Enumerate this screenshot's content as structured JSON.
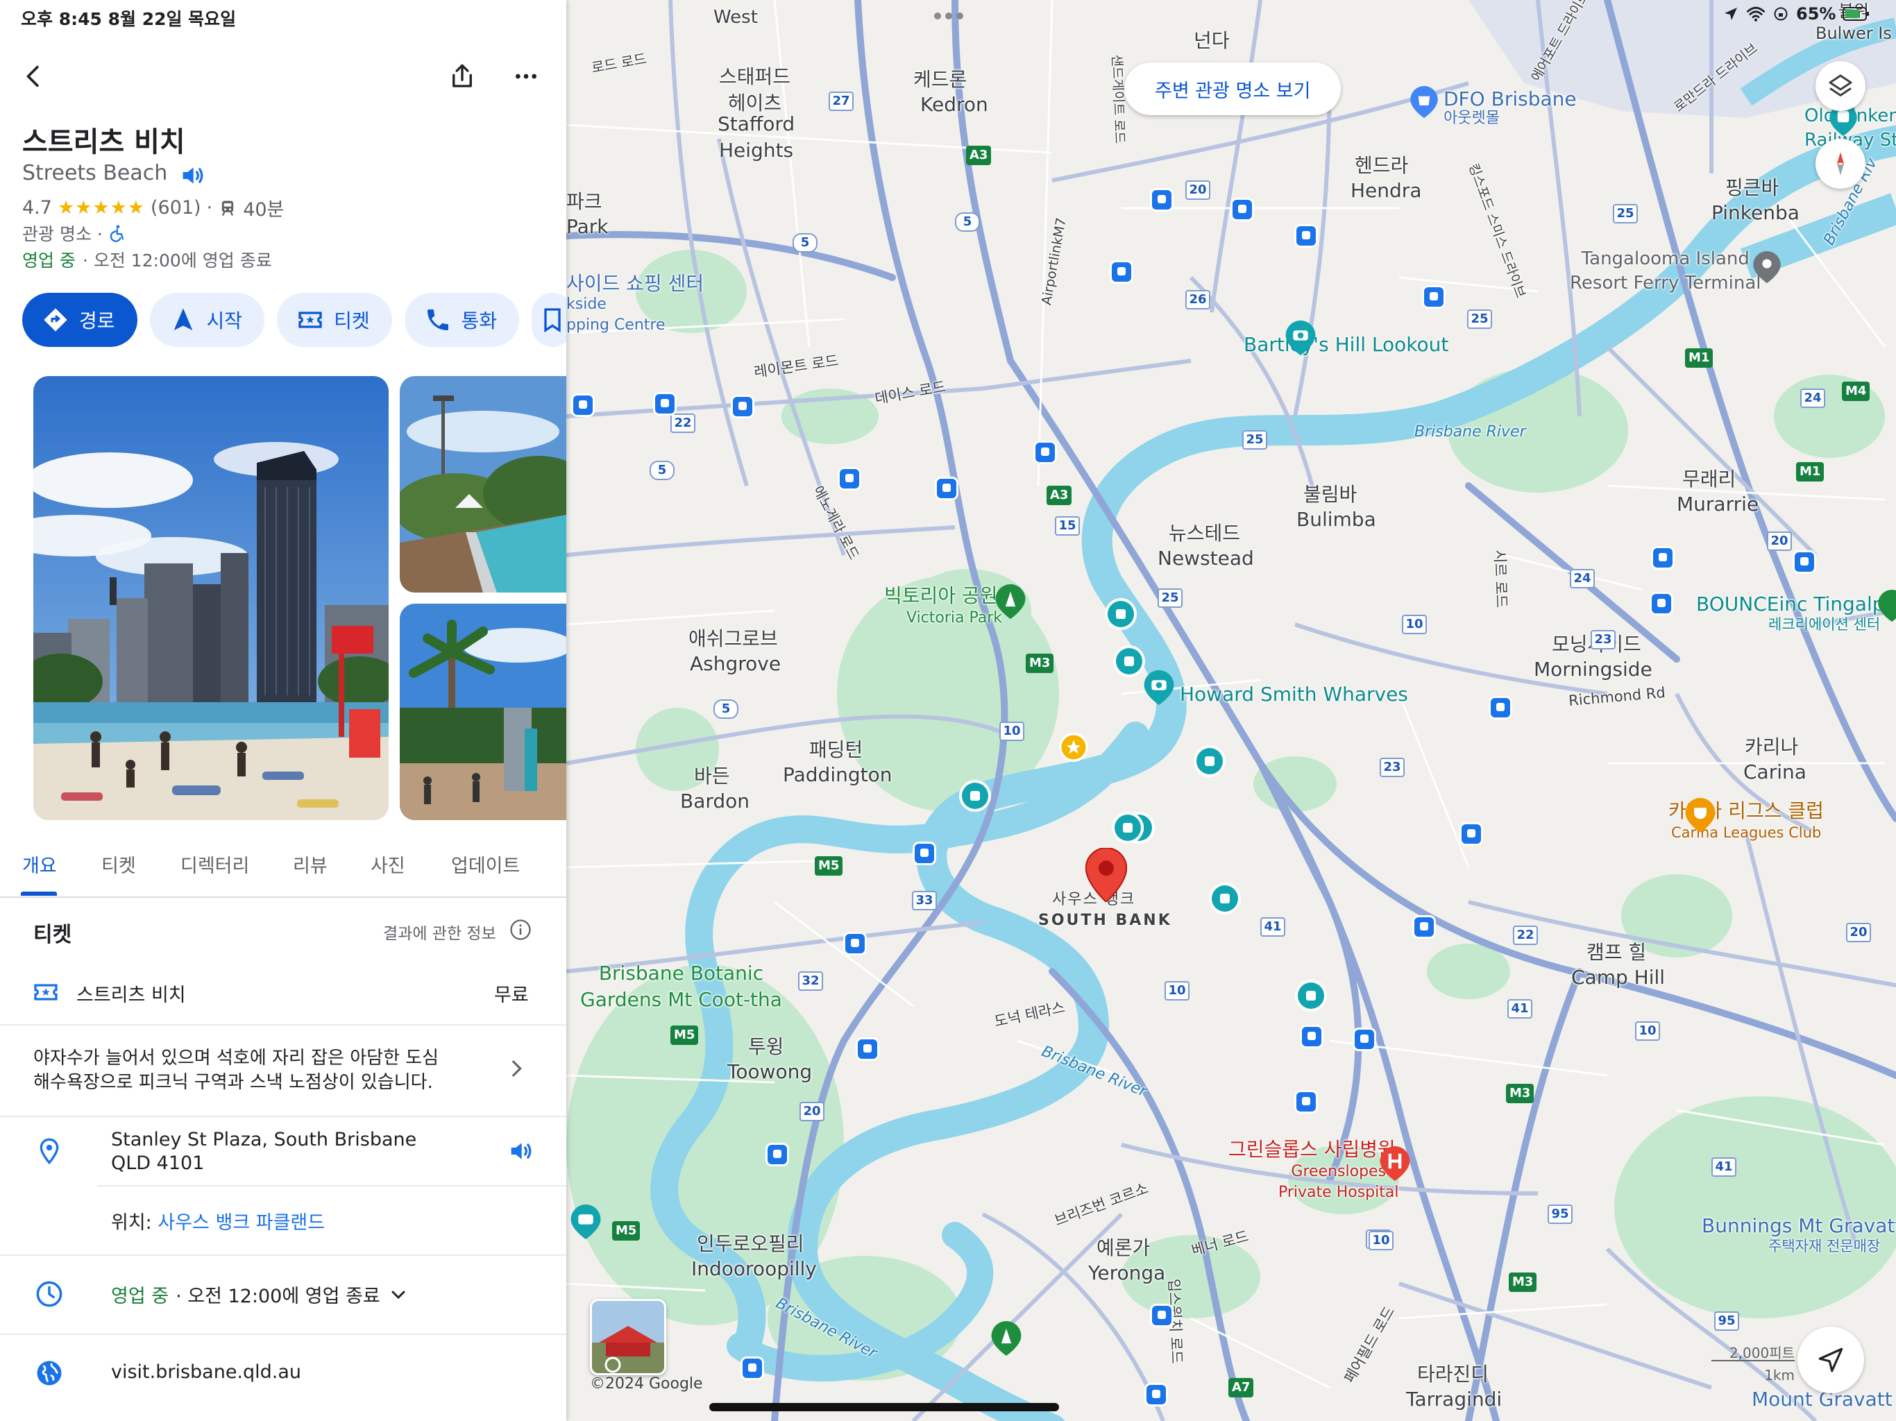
{
  "status_bar": {
    "time_date": "오후 8:45   8월 22일 목요일",
    "battery": "65%"
  },
  "place": {
    "title": "스트리츠 비치",
    "subtitle": "Streets Beach",
    "rating": "4.7",
    "stars": "★★★★★",
    "reviews": "(601)",
    "transit_time": "40분",
    "category": "관광 명소 ·",
    "open_status": "영업 중",
    "hours_summary": "· 오전 12:00에 영업 종료"
  },
  "actions": {
    "directions": "경로",
    "start": "시작",
    "tickets": "티켓",
    "call": "통화"
  },
  "tabs": [
    "개요",
    "티켓",
    "디렉터리",
    "리뷰",
    "사진",
    "업데이트"
  ],
  "tickets_section": {
    "title": "티켓",
    "about": "결과에 관한 정보",
    "item_name": "스트리츠 비치",
    "item_price": "무료"
  },
  "description": {
    "line1": "야자수가 늘어서 있으며 석호에 자리 잡은 아담한 도심",
    "line2": "해수욕장으로 피크닉 구역과 스낵 노점상이 있습니다."
  },
  "address": {
    "line1": "Stanley St Plaza, South Brisbane",
    "line2": "QLD 4101",
    "location_prefix": "위치:",
    "location_link": "사우스 뱅크 파클랜드"
  },
  "hours": {
    "status": "영업 중",
    "detail": "· 오전 12:00에 영업 종료"
  },
  "website": "visit.brisbane.qld.au",
  "map": {
    "nearby_button": "주변 관광 명소 보기",
    "copyright": "©2024 Google",
    "scale_ft": "2,000피트",
    "scale_km": "1km",
    "labels": {
      "west": "West",
      "road_north1": "로드 로드",
      "stafford_ko": "스태퍼드\n헤이츠",
      "stafford_en": "Stafford\nHeights",
      "kedron_ko": "케드론",
      "kedron_en": "Kedron",
      "nundah": "넌다",
      "dfo_en": "DFO Brisbane",
      "dfo_ko": "아웃렛몰",
      "bulwer": "불워\nBulwer Is",
      "hendra_ko": "헨드라",
      "hendra_en": "Hendra",
      "pinkenba_ko": "핑큰바",
      "pinkenba_en": "Pinkenba",
      "park_ko": "파크",
      "park_en": "Park",
      "shopping_ko": "사이드 쇼핑 센터",
      "shopping_en": "kside\npping Centre",
      "tangalooma": "Tangalooma Island\nResort Ferry Terminal",
      "old_pinkenba": "Old Pinken\nRailway Sta",
      "bartleys": "Bartley's Hill Lookout",
      "raymont_rd": "레이몬트 로드",
      "days_rd": "데이스 로드",
      "airportlink": "AirportlinkM7",
      "brisbane_river_top": "Brisbane River",
      "bulimba_ko": "불림바",
      "bulimba_en": "Bulimba",
      "murarrie_ko": "무래리",
      "murarrie_en": "Murarrie",
      "newstead_ko": "뉴스테드",
      "newstead_en": "Newstead",
      "victoria_ko": "빅토리아 공원",
      "victoria_en": "Victoria Park",
      "enoggera_rd": "에노게라 로드",
      "ashgrove_ko": "애쉬그로브",
      "ashgrove_en": "Ashgrove",
      "howard": "Howard Smith Wharves",
      "morningside_ko": "모닝사이드",
      "morningside_en": "Morningside",
      "richmond_rd": "Richmond Rd",
      "bounce_en": "BOUNCEinc Tingalpa",
      "bounce_ko": "레크리에이션 센터",
      "paddington_ko": "패딩턴",
      "paddington_en": "Paddington",
      "bardon_ko": "바든",
      "bardon_en": "Bardon",
      "carina_ko": "카리나",
      "carina_en": "Carina",
      "carina_league_ko": "카리나 리그스 클럽",
      "carina_league_en": "Carina Leagues Club",
      "southbank_ko": "사우스 뱅크",
      "southbank_en": "SOUTH BANK",
      "camphill_ko": "캠프 힐",
      "camphill_en": "Camp Hill",
      "botanic": "Brisbane Botanic\nGardens Mt Coot-tha",
      "dutton_tce": "도넉 테라스",
      "brisbane_river_mid": "Brisbane River",
      "toowong_ko": "투윙",
      "toowong_en": "Toowong",
      "greenslopes_ko": "그린슬롭스 사립병원",
      "greenslopes_en": "Greenslopes\nPrivate Hospital",
      "bunnings_en": "Bunnings Mt Gravatt",
      "bunnings_ko": "주택자재 전문매장",
      "indooroopilly_ko": "인두로오필리",
      "indooroopilly_en": "Indooroopilly",
      "yeronga_ko": "예론가",
      "yeronga_en": "Yeronga",
      "venner_rd": "베너 로드",
      "brisbane_river_low": "Brisbane River",
      "tarragindi_ko": "타라진디",
      "tarragindi_en": "Tarragindi",
      "mtgravatt": "Mount Gravatt O",
      "bris_corso": "브리즈번 코르소",
      "fairfield_rd": "페어필드 로드",
      "ipswich_rd": "입스위치 로드",
      "sw_rd": "시르 로드",
      "kingsford": "킹스포드 스미스 드라이브",
      "sandgate_rd": "샌드게이트 로드",
      "lomandra": "로만드라 드라이브",
      "airport_dr": "에어포트 드라이브",
      "bris_river_right": "Brisbane Riv"
    },
    "shields": [
      "27",
      "A3",
      "20",
      "5",
      "5",
      "25",
      "26",
      "25",
      "M1",
      "24",
      "M4",
      "M1",
      "22",
      "5",
      "A3",
      "15",
      "25",
      "25",
      "20",
      "24",
      "M3",
      "10",
      "23",
      "10",
      "5",
      "23",
      "M5",
      "33",
      "32",
      "41",
      "22",
      "20",
      "41",
      "10",
      "10",
      "M5",
      "20",
      "95",
      "M3",
      "41",
      "10",
      "95",
      "A7",
      "M3",
      "10",
      "5"
    ]
  },
  "colors": {
    "accent": "#0b57d0",
    "open_green": "#188038",
    "water": "#8fd4ea",
    "park": "#bde6c9",
    "pin_red": "#ea4335",
    "teal": "#12a4af",
    "transit": "#1a73e8"
  }
}
